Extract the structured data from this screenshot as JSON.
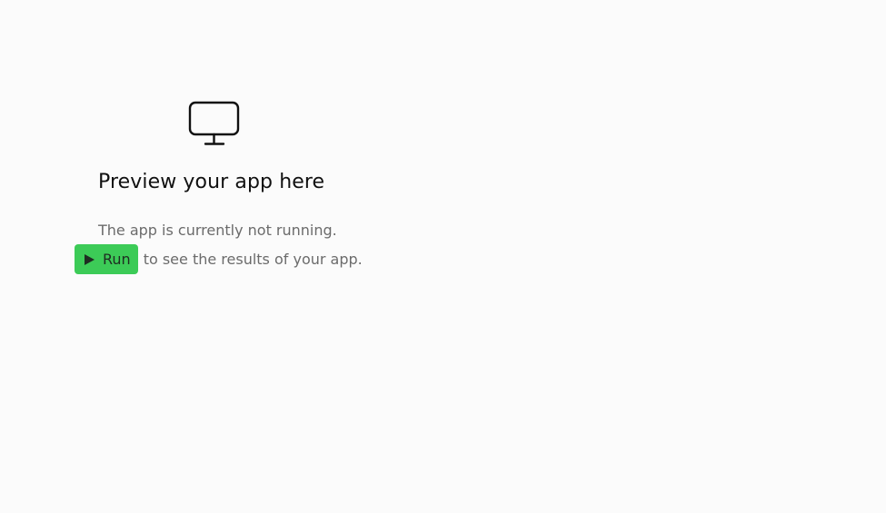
{
  "preview": {
    "icon": "monitor-icon",
    "title": "Preview your app here",
    "status_text": "The app is currently not running.",
    "run_button_label": "Run",
    "run_button_icon": "play-icon",
    "run_suffix_text": "to see the results of your app."
  },
  "colors": {
    "background": "#fbfbfb",
    "run_button": "#3ccb57",
    "title": "#111111",
    "muted_text": "#6b6b6b"
  }
}
